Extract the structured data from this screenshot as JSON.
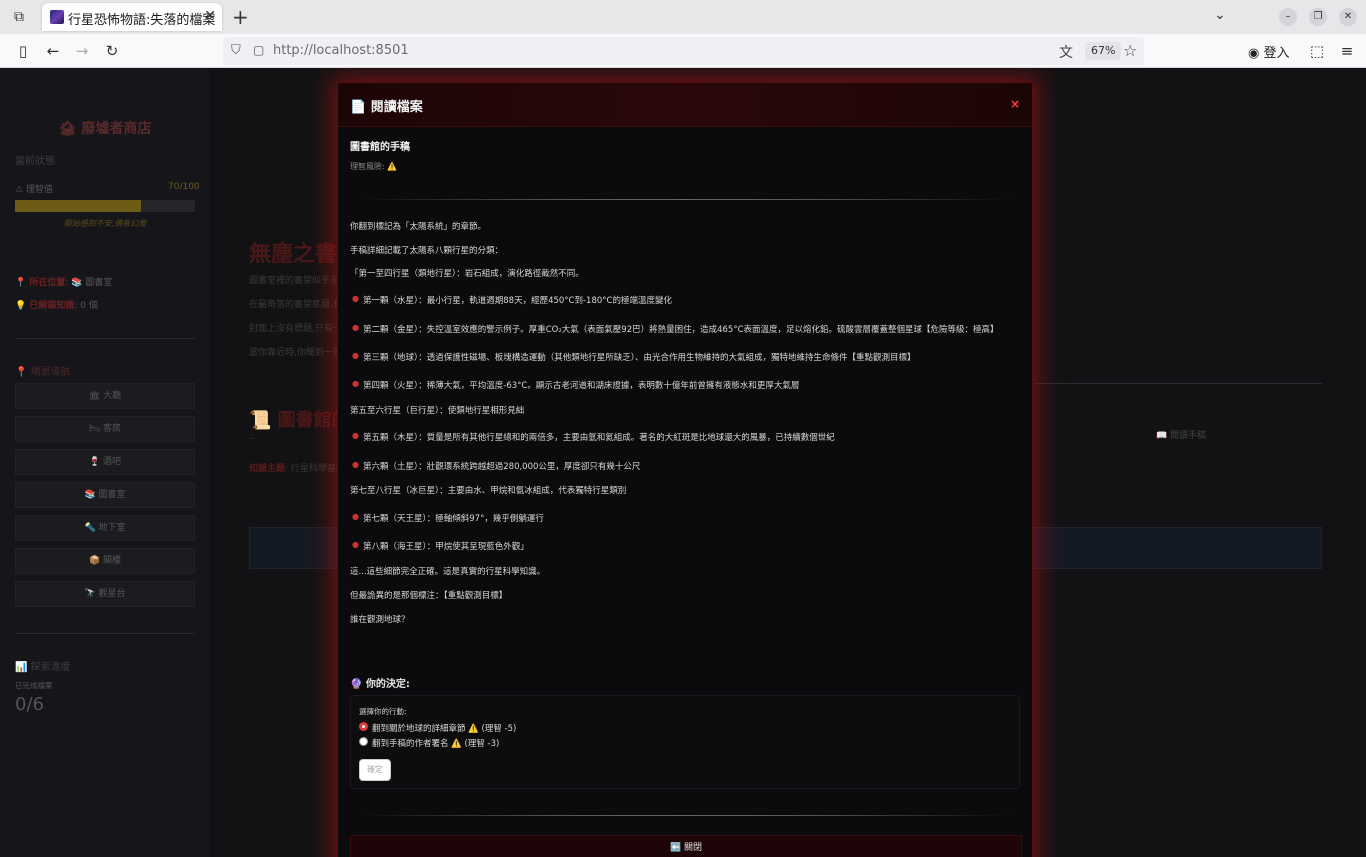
{
  "browser": {
    "tab_title": "行星恐怖物語:失落的檔案",
    "url": "http://localhost:8501",
    "zoom": "67%",
    "account_label": "登入"
  },
  "sidebar": {
    "title": "🏚 廢墟者商店",
    "status_header": "當前狀態",
    "sanity_label": "⚠ 理智值",
    "sanity_value": "70/100",
    "sanity_fraction": 0.7,
    "sanity_note": "開始感到不安,偶有幻覺",
    "location_label": "📍 所在位置",
    "location_value": ": 📚 圖書室",
    "knowledge_label": "💡 已解鎖知識",
    "knowledge_value": ": 0 個",
    "scene_nav_header": "📍 場景導航",
    "scenes": [
      "🏛 大廳",
      "🛏 客房",
      "🍷 酒吧",
      "📚 圖書室",
      "🔦 地下室",
      "📦 閣樓",
      "🔭 觀星台"
    ],
    "progress_header": "📊 探索進度",
    "progress_label": "已完成檔案",
    "progress_value": "0/6"
  },
  "main": {
    "title": "無塵之書",
    "paragraphs": [
      "圖書室裡的書架似乎永",
      "在最角落的書架底層,有",
      "封面上沒有標題,只有一",
      "當你靠近時,你聞到一股"
    ],
    "section_title": "📜 圖書館的",
    "dots": "..",
    "topic_label": "知識主題",
    "topic_value": ": 行星科學基礎",
    "read_note_button": "📖 閱讀手稿"
  },
  "modal": {
    "title": "📄 閱讀檔案",
    "close_icon": "×",
    "doc_title": "圖書館的手稿",
    "risk_label": "理智風險: ",
    "risk_icon": "⚠️",
    "lines": {
      "intro1": "你翻到標記為「太陽系統」的章節。",
      "intro2": "手稿詳細記載了太陽系八顆行星的分類：",
      "group1": "「第一至四行星（類地行星）：岩石組成，演化路徑截然不同。",
      "p1": "第一顆（水星）：最小行星，軌道週期88天，經歷450°C到-180°C的極端溫度變化",
      "p2": "第二顆（金星）：失控溫室效應的警示例子。厚重CO₂大氣（表面氣壓92巴）將熱量困住，造成465°C表面溫度，足以熔化鉛。硫酸雲層覆蓋整個星球【危險等級：極高】",
      "p3": "第三顆（地球）：透過保護性磁場、板塊構造運動（其他類地行星所缺乏）、由光合作用生物維持的大氣組成，獨特地維持生命條件【重點觀測目標】",
      "p4": "第四顆（火星）：稀薄大氣，平均溫度-63°C。顯示古老河道和湖床證據，表明數十億年前曾擁有液態水和更厚大氣層",
      "group2": "第五至六行星（巨行星）：使類地行星相形見絀",
      "p5": "第五顆（木星）：質量是所有其他行星總和的兩倍多，主要由氫和氦組成。著名的大紅斑是比地球還大的風暴，已持續數個世紀",
      "p6": "第六顆（土星）：壯觀環系統跨越超過280,000公里，厚度卻只有幾十公尺",
      "group3": "第七至八行星（冰巨星）：主要由水、甲烷和氨冰組成，代表獨特行星類別",
      "p7": "第七顆（天王星）：極軸傾斜97°，幾乎側躺運行",
      "p8": "第八顆（海王星）：甲烷使其呈現藍色外觀」",
      "outro1": "這...這些細節完全正確。這是真實的行星科學知識。",
      "outro2": "但最詭異的是那個標注：【重點觀測目標】",
      "outro3": "誰在觀測地球？"
    },
    "decision_title": "🔮 你的決定:",
    "decision_prompt": "選擇你的行動:",
    "option1": "翻到關於地球的詳細章節",
    "option1_cost": " (理智 -5)",
    "option2": "翻到手稿的作者署名",
    "option2_cost": " (理智 -3)",
    "confirm_label": "確定",
    "close_button": "⬅️ 關閉"
  }
}
